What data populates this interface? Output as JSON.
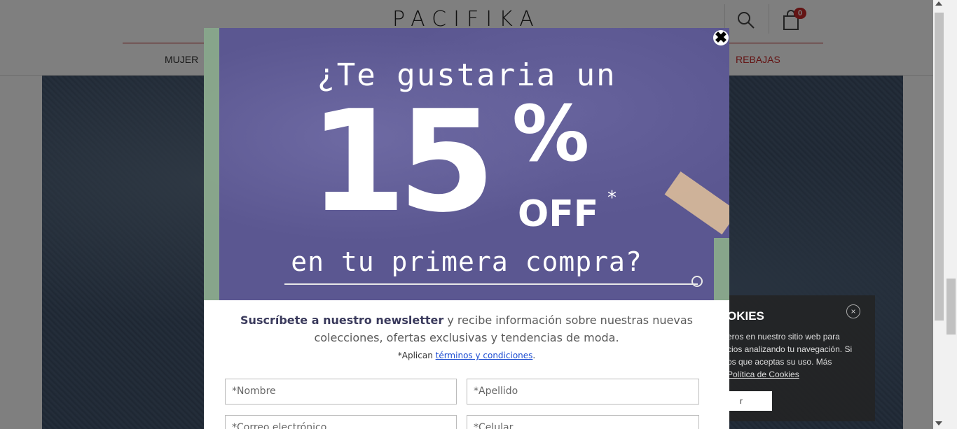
{
  "header": {
    "logo": "PACIFIKA",
    "cart_count": "0",
    "nav": {
      "mujer": "MUJER",
      "rebajas": "REBAJAS"
    }
  },
  "cookies": {
    "title": "OKIES",
    "text_1": "eros en nuestro sitio web para",
    "text_2": "cios analizando tu navegación. Si",
    "text_3": "os que aceptas su uso. Más",
    "link": "Política de Cookies",
    "button": "r",
    "close": "×"
  },
  "modal": {
    "close": "✖",
    "banner": {
      "line1": "¿Te gustaria un",
      "number": "15",
      "percent": "%",
      "off": "OFF",
      "star": "*",
      "line2": "en tu primera compra?"
    },
    "description_bold": "Suscríbete a nuestro newsletter",
    "description_rest": " y recibe información sobre nuestras nuevas colecciones, ofertas exclusivas y tendencias de moda.",
    "terms_prefix": "*Aplican ",
    "terms_link": "términos y condiciones",
    "terms_suffix": ".",
    "fields": {
      "nombre": "*Nombre",
      "apellido": "*Apellido",
      "correo": "*Correo electrónico",
      "celular": "*Celular"
    }
  },
  "colors": {
    "banner_purple": "#5b5791",
    "accent_red": "#c62828",
    "link_blue": "#1a4bd1"
  }
}
